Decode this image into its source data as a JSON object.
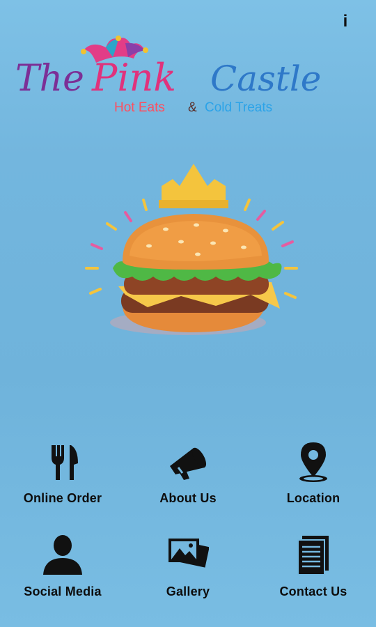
{
  "header": {
    "info_label": "i"
  },
  "logo": {
    "brand_the": "The",
    "brand_pink": "Pink",
    "brand_castle": "Castle",
    "tag_hot": "Hot Eats",
    "tag_amp": "&",
    "tag_cold": "Cold Treats"
  },
  "menu": {
    "items": [
      {
        "label": "Online Order",
        "icon": "fork-knife-icon"
      },
      {
        "label": "About Us",
        "icon": "megaphone-icon"
      },
      {
        "label": "Location",
        "icon": "map-pin-icon"
      },
      {
        "label": "Social Media",
        "icon": "person-icon"
      },
      {
        "label": "Gallery",
        "icon": "photo-gallery-icon"
      },
      {
        "label": "Contact Us",
        "icon": "document-icon"
      }
    ]
  },
  "colors": {
    "background": "#74b8df",
    "brand_purple": "#7c2f96",
    "brand_pink": "#e0327c",
    "brand_blue": "#2e78c8",
    "tag_red": "#ff4d5e",
    "tag_blue": "#2ba3e8",
    "icon_black": "#111111"
  }
}
